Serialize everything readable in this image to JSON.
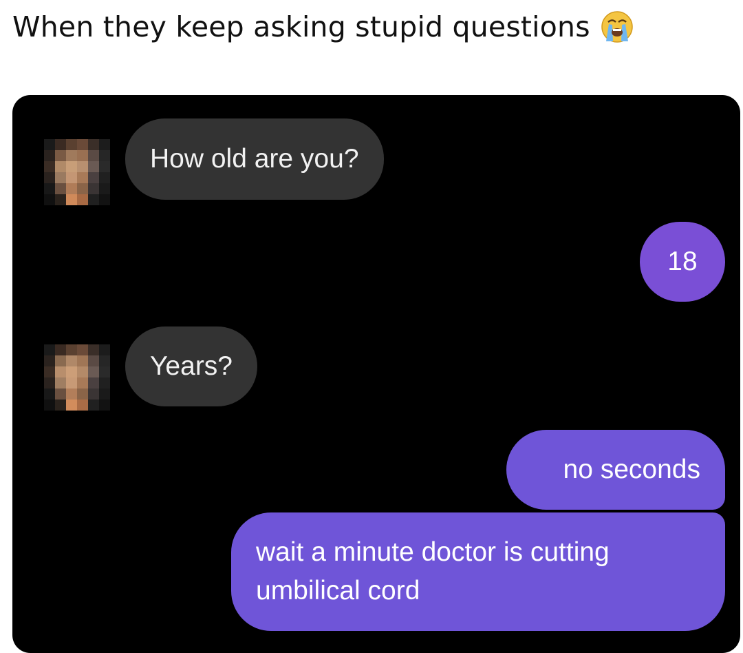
{
  "caption": {
    "text": "When they keep asking stupid questions",
    "emoji": "loudly-crying-face-icon"
  },
  "chat": {
    "messages": [
      {
        "sender": "other",
        "text": "How old are you?"
      },
      {
        "sender": "me",
        "text": "18"
      },
      {
        "sender": "other",
        "text": "Years?"
      },
      {
        "sender": "me",
        "text": "no seconds"
      },
      {
        "sender": "me",
        "text": "wait a minute doctor is cutting umbilical cord"
      }
    ]
  },
  "colors": {
    "chat_background": "#000000",
    "incoming_bubble": "#333333",
    "outgoing_bubble": "#7a4fd6",
    "outgoing_bubble_alt": "#6f55d8"
  }
}
